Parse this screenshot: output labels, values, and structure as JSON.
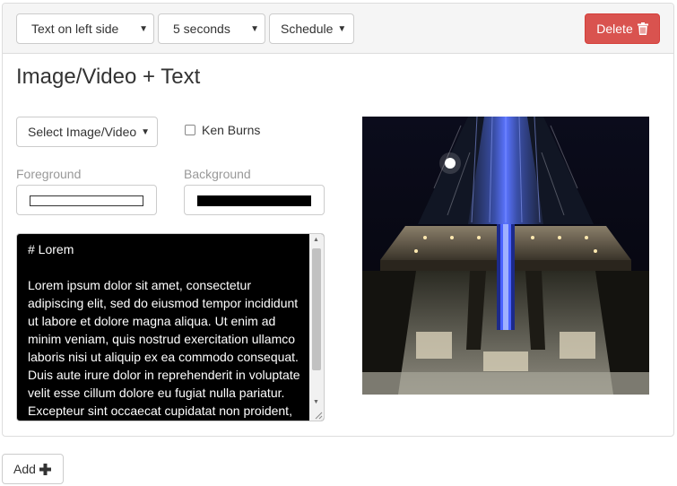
{
  "toolbar": {
    "layout_select": "Text on left side",
    "duration_select": "5 seconds",
    "schedule_label": "Schedule",
    "delete_label": "Delete"
  },
  "section": {
    "title": "Image/Video + Text",
    "select_media_label": "Select Image/Video",
    "ken_burns_label": "Ken Burns",
    "ken_burns_checked": false,
    "foreground_label": "Foreground",
    "foreground_color": "#ffffff",
    "background_label": "Background",
    "background_color": "#000000",
    "text_content": "# Lorem\n\nLorem ipsum dolor sit amet, consectetur adipiscing elit, sed do eiusmod tempor incididunt ut labore et dolore magna aliqua. Ut enim ad minim veniam, quis nostrud exercitation ullamco laboris nisi ut aliquip ex ea commodo consequat. Duis aute irure dolor in reprehenderit in voluptate velit esse cillum dolore eu fugiat nulla pariatur. Excepteur sint occaecat cupidatat non proident, sunt in culpa qui officia deserunt mollit anim id est laborum."
  },
  "footer": {
    "add_label": "Add"
  },
  "colors": {
    "danger": "#d9534f",
    "accent_blue": "#2b3cff"
  },
  "icons": {
    "delete": "trash-icon",
    "add": "plus-icon",
    "dropdown": "caret-down-icon"
  }
}
